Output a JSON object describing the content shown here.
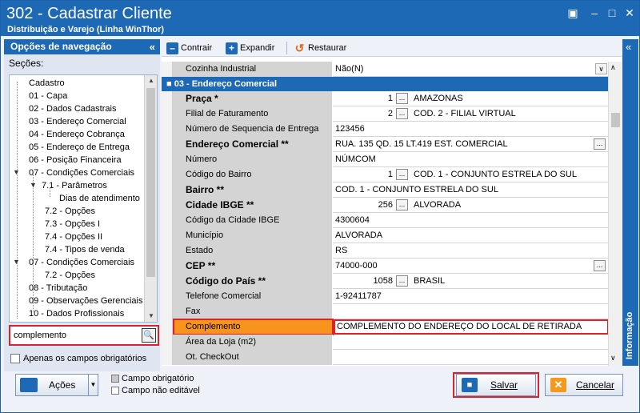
{
  "window": {
    "title": "302 - Cadastrar Cliente",
    "subtitle": "Distribuição e Varejo (Linha WinThor)"
  },
  "nav": {
    "header": "Opções de navegação",
    "sections_label": "Seções:",
    "items": [
      "Cadastro",
      "01 - Capa",
      "02 - Dados Cadastrais",
      "03 - Endereço Comercial",
      "04 - Endereço Cobrança",
      "05 - Endereço de Entrega",
      "06 - Posição Financeira",
      "07 - Condições Comerciais",
      "7.1 - Parâmetros",
      "Dias de atendimento",
      "7.2 - Opções",
      "7.3 - Opções I",
      "7.4 - Opções II",
      "7.4 - Tipos de venda",
      "07 - Condições Comerciais",
      "7.2 - Opções",
      "08 - Tributação",
      "09 - Observações Gerenciais",
      "10 - Dados Profissionais"
    ],
    "search_value": "complemento",
    "only_required_label": "Apenas os campos obrigatórios"
  },
  "toolbar": {
    "collapse": "Contrair",
    "expand": "Expandir",
    "restore": "Restaurar"
  },
  "grid": {
    "top_row": {
      "label": "Cozinha Industrial",
      "value": "Não(N)"
    },
    "section": "03 - Endereço Comercial",
    "rows": [
      {
        "label": "Praça *",
        "num": "1",
        "value": "AMAZONAS"
      },
      {
        "label": "Filial de Faturamento",
        "num": "2",
        "value": "COD. 2 - FILIAL VIRTUAL"
      },
      {
        "label": "Número de Sequencia de Entrega",
        "value": "123456"
      },
      {
        "label": "Endereço Comercial **",
        "value": "RUA. 135 QD. 15 LT.419 EST. COMERCIAL"
      },
      {
        "label": "Número",
        "value": "NÚMCOM"
      },
      {
        "label": "Código do Bairro",
        "num": "1",
        "value": "COD. 1 - CONJUNTO ESTRELA DO SUL"
      },
      {
        "label": "Bairro **",
        "value": "COD. 1 - CONJUNTO ESTRELA DO SUL"
      },
      {
        "label": "Cidade IBGE **",
        "num": "256",
        "value": "ALVORADA"
      },
      {
        "label": "Código da Cidade IBGE",
        "value": "4300604"
      },
      {
        "label": "Município",
        "value": "ALVORADA"
      },
      {
        "label": "Estado",
        "value": "RS"
      },
      {
        "label": "CEP **",
        "value": "74000-000"
      },
      {
        "label": "Código do País **",
        "num": "1058",
        "value": "BRASIL"
      },
      {
        "label": "Telefone Comercial",
        "value": "1-92411787"
      },
      {
        "label": "Fax",
        "value": ""
      },
      {
        "label": "Complemento",
        "value": "COMPLEMENTO DO ENDEREÇO DO LOCAL DE RETIRADA"
      },
      {
        "label": "Área da Loja (m2)",
        "value": ""
      },
      {
        "label": "Ot. CheckOut",
        "value": ""
      }
    ]
  },
  "side_tab": "Informação",
  "footer": {
    "actions": "Ações",
    "legend_required": "Campo obrigatório",
    "legend_readonly": "Campo não editável",
    "save": "Salvar",
    "cancel": "Cancelar"
  },
  "colors": {
    "accent": "#1d69b6",
    "highlight_border": "#e0212b",
    "selected_row": "#f7941d"
  }
}
